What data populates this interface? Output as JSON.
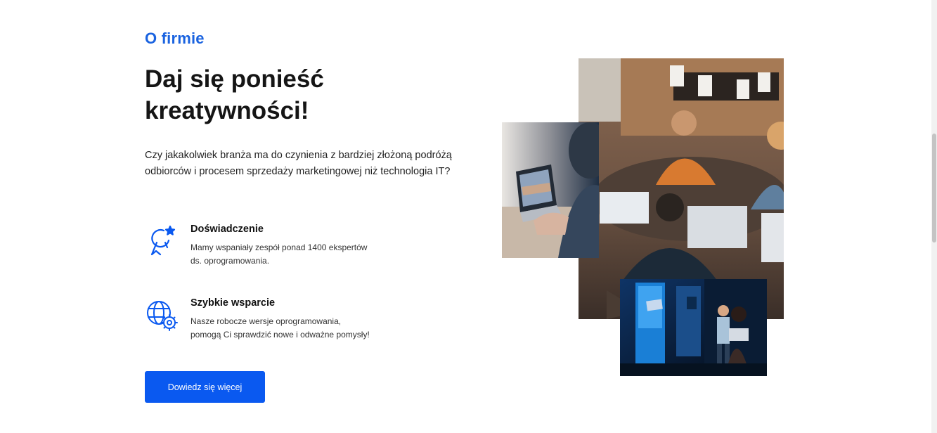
{
  "section": {
    "label": "O firmie",
    "heading_line1": "Daj się ponieść",
    "heading_line2": "kreatywności!",
    "intro": "Czy jakakolwiek branża ma do czynienia z bardziej złożoną podróżą odbiorców i procesem sprzedaży marketingowej niż technologia IT?"
  },
  "features": [
    {
      "icon": "award-medal-icon",
      "title": "Doświadczenie",
      "description": "Mamy wspaniały zespół ponad 1400 ekspertów\nds. oprogramowania."
    },
    {
      "icon": "globe-gear-icon",
      "title": "Szybkie wsparcie",
      "description": "Nasze robocze wersje oprogramowania,\npomogą Ci sprawdzić nowe i odważne pomysły!"
    }
  ],
  "cta": {
    "label": "Dowiedz się więcej"
  },
  "colors": {
    "accent": "#0a59f0",
    "label_blue": "#1a63e0",
    "heading": "#151515"
  }
}
